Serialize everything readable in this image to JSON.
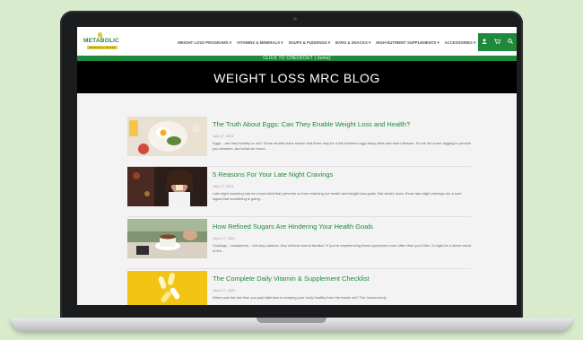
{
  "logo": {
    "word": "METABOLIC",
    "sub": "RESEARCH CENTER"
  },
  "nav": [
    "WEIGHT LOSS PROGRAMS ▾",
    "VITAMINS & MINERALS ▾",
    "SOUPS & PUDDINGS ▾",
    "BARS & SNACKS ▾",
    "HIGH NUTRIENT SUPPLEMENTS ▾",
    "ACCESSORIES ▾"
  ],
  "header_icons": [
    "user-icon",
    "cart-icon",
    "search-icon"
  ],
  "checkout_bar": "CLICK TO CHECKOUT ( items)",
  "page_title": "WEIGHT LOSS MRC BLOG",
  "colors": {
    "brand_green": "#1f8a3c",
    "hero_bg": "#000000"
  },
  "posts": [
    {
      "title": "The Truth About Eggs: Can They Enable Weight Loss and Health?",
      "date": "July 27, 2021",
      "excerpt": "Eggs... are they healthy or not? Some studies have shown that there may be a link between egg-heavy diets and heart disease. So we did some digging to provide you answers. And what we found..."
    },
    {
      "title": "5 Reasons For Your Late Night Cravings",
      "date": "July 27, 2021",
      "excerpt": "Late-night snacking can be a bad habit that prevents us from reaching our health and weight loss goals. But what's more, those late-night cravings are a sure signal that something is going..."
    },
    {
      "title": "How Refined Sugars Are Hindering Your Health Goals",
      "date": "June 17, 2021",
      "excerpt": "Cravings... headaches... mid-day crashes. Any of these sound familiar? If you're experiencing these symptoms more often than you'd like, it might be a direct result of the..."
    },
    {
      "title": "The Complete Daily Vitamin & Supplement Checklist",
      "date": "June 17, 2021",
      "excerpt": "When was the last time you paid attention to keeping your body healthy from the inside out? The human body"
    }
  ]
}
